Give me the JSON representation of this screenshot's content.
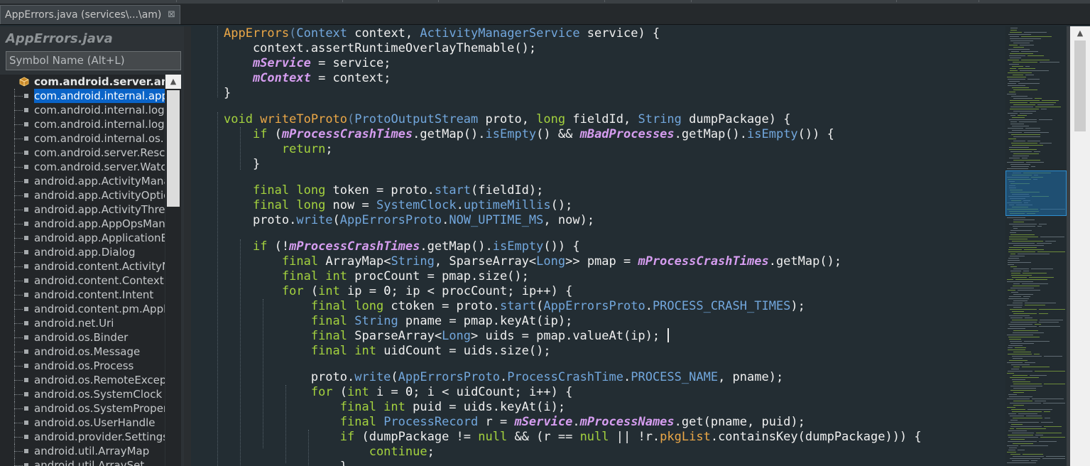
{
  "tab": {
    "title": "AppErrors.java (services\\...\\am)",
    "close": "⊠"
  },
  "outline": {
    "title": "AppErrors.java",
    "search_placeholder": "Symbol Name (Alt+L)",
    "items": [
      {
        "label": "com.android.server.am",
        "kind": "package",
        "bold": true
      },
      {
        "label": "com.android.internal.app",
        "kind": "import",
        "selected": true
      },
      {
        "label": "com.android.internal.logg",
        "kind": "import"
      },
      {
        "label": "com.android.internal.logg",
        "kind": "import"
      },
      {
        "label": "com.android.internal.os.P",
        "kind": "import"
      },
      {
        "label": "com.android.server.Rescu",
        "kind": "import"
      },
      {
        "label": "com.android.server.Watch",
        "kind": "import"
      },
      {
        "label": "android.app.ActivityMana",
        "kind": "import"
      },
      {
        "label": "android.app.ActivityOptio",
        "kind": "import"
      },
      {
        "label": "android.app.ActivityThrea",
        "kind": "import"
      },
      {
        "label": "android.app.AppOpsMan",
        "kind": "import"
      },
      {
        "label": "android.app.ApplicationE",
        "kind": "import"
      },
      {
        "label": "android.app.Dialog",
        "kind": "import"
      },
      {
        "label": "android.content.ActivityN",
        "kind": "import"
      },
      {
        "label": "android.content.Context",
        "kind": "import"
      },
      {
        "label": "android.content.Intent",
        "kind": "import"
      },
      {
        "label": "android.content.pm.Appl",
        "kind": "import"
      },
      {
        "label": "android.net.Uri",
        "kind": "import"
      },
      {
        "label": "android.os.Binder",
        "kind": "import"
      },
      {
        "label": "android.os.Message",
        "kind": "import"
      },
      {
        "label": "android.os.Process",
        "kind": "import"
      },
      {
        "label": "android.os.RemoteExcept",
        "kind": "import"
      },
      {
        "label": "android.os.SystemClock",
        "kind": "import"
      },
      {
        "label": "android.os.SystemProper",
        "kind": "import"
      },
      {
        "label": "android.os.UserHandle",
        "kind": "import"
      },
      {
        "label": "android.provider.Settings",
        "kind": "import"
      },
      {
        "label": "android.util.ArrayMap",
        "kind": "import"
      },
      {
        "label": "android.util.ArraySet",
        "kind": "import"
      }
    ]
  },
  "colors": {
    "keyword": "#a4d23e",
    "type": "#72a7dd",
    "field": "#d69df0",
    "method": "#eca847",
    "number": "#ffffff",
    "text": "#e8e2b7",
    "selection": "#0a64c8",
    "editor_bg": "#232d33"
  },
  "code_lines": [
    [
      {
        "c": "m",
        "t": "AppErrors"
      },
      {
        "c": "c",
        "t": "("
      },
      {
        "c": "t",
        "t": "Context"
      },
      {
        "c": "p",
        "t": " context, "
      },
      {
        "c": "t",
        "t": "ActivityManagerService"
      },
      {
        "c": "p",
        "t": " service) {"
      }
    ],
    [
      {
        "c": "p",
        "t": "    context.assertRuntimeOverlayThemable();"
      }
    ],
    [
      {
        "c": "p",
        "t": "    "
      },
      {
        "c": "f",
        "t": "mService"
      },
      {
        "c": "p",
        "t": " = service;"
      }
    ],
    [
      {
        "c": "p",
        "t": "    "
      },
      {
        "c": "f",
        "t": "mContext"
      },
      {
        "c": "p",
        "t": " = context;"
      }
    ],
    [
      {
        "c": "p",
        "t": "}"
      }
    ],
    [],
    [
      {
        "c": "k",
        "t": "void"
      },
      {
        "c": "p",
        "t": " "
      },
      {
        "c": "m",
        "t": "writeToProto"
      },
      {
        "c": "c",
        "t": "("
      },
      {
        "c": "t",
        "t": "ProtoOutputStream"
      },
      {
        "c": "p",
        "t": " proto, "
      },
      {
        "c": "k",
        "t": "long"
      },
      {
        "c": "p",
        "t": " fieldId, "
      },
      {
        "c": "t",
        "t": "String"
      },
      {
        "c": "p",
        "t": " dumpPackage) {"
      }
    ],
    [
      {
        "c": "p",
        "t": "    "
      },
      {
        "c": "k",
        "t": "if"
      },
      {
        "c": "p",
        "t": " ("
      },
      {
        "c": "f",
        "t": "mProcessCrashTimes"
      },
      {
        "c": "p",
        "t": ".getMap()."
      },
      {
        "c": "t",
        "t": "isEmpty"
      },
      {
        "c": "p",
        "t": "() && "
      },
      {
        "c": "f",
        "t": "mBadProcesses"
      },
      {
        "c": "p",
        "t": ".getMap()."
      },
      {
        "c": "t",
        "t": "isEmpty"
      },
      {
        "c": "p",
        "t": "()) {"
      }
    ],
    [
      {
        "c": "p",
        "t": "        "
      },
      {
        "c": "k",
        "t": "return"
      },
      {
        "c": "p",
        "t": ";"
      }
    ],
    [
      {
        "c": "p",
        "t": "    }"
      }
    ],
    [],
    [
      {
        "c": "p",
        "t": "    "
      },
      {
        "c": "k",
        "t": "final long"
      },
      {
        "c": "p",
        "t": " token = proto."
      },
      {
        "c": "t",
        "t": "start"
      },
      {
        "c": "p",
        "t": "(fieldId);"
      }
    ],
    [
      {
        "c": "p",
        "t": "    "
      },
      {
        "c": "k",
        "t": "final long"
      },
      {
        "c": "p",
        "t": " now = "
      },
      {
        "c": "t",
        "t": "SystemClock"
      },
      {
        "c": "p",
        "t": "."
      },
      {
        "c": "t",
        "t": "uptimeMillis"
      },
      {
        "c": "p",
        "t": "();"
      }
    ],
    [
      {
        "c": "p",
        "t": "    proto."
      },
      {
        "c": "t",
        "t": "write"
      },
      {
        "c": "p",
        "t": "("
      },
      {
        "c": "t",
        "t": "AppErrorsProto"
      },
      {
        "c": "p",
        "t": "."
      },
      {
        "c": "t",
        "t": "NOW_UPTIME_MS"
      },
      {
        "c": "p",
        "t": ", now);"
      }
    ],
    [],
    [
      {
        "c": "p",
        "t": "    "
      },
      {
        "c": "k",
        "t": "if"
      },
      {
        "c": "p",
        "t": " (!"
      },
      {
        "c": "f",
        "t": "mProcessCrashTimes"
      },
      {
        "c": "p",
        "t": ".getMap()."
      },
      {
        "c": "t",
        "t": "isEmpty"
      },
      {
        "c": "p",
        "t": "()) {"
      }
    ],
    [
      {
        "c": "p",
        "t": "        "
      },
      {
        "c": "k",
        "t": "final"
      },
      {
        "c": "p",
        "t": " ArrayMap<"
      },
      {
        "c": "t",
        "t": "String"
      },
      {
        "c": "p",
        "t": ", SparseArray<"
      },
      {
        "c": "t",
        "t": "Long"
      },
      {
        "c": "p",
        "t": ">> pmap = "
      },
      {
        "c": "f",
        "t": "mProcessCrashTimes"
      },
      {
        "c": "p",
        "t": ".getMap();"
      }
    ],
    [
      {
        "c": "p",
        "t": "        "
      },
      {
        "c": "k",
        "t": "final int"
      },
      {
        "c": "p",
        "t": " procCount = pmap.size();"
      }
    ],
    [
      {
        "c": "p",
        "t": "        "
      },
      {
        "c": "k",
        "t": "for"
      },
      {
        "c": "p",
        "t": " ("
      },
      {
        "c": "k",
        "t": "int"
      },
      {
        "c": "p",
        "t": " ip = "
      },
      {
        "c": "n",
        "t": "0"
      },
      {
        "c": "p",
        "t": "; ip < procCount; ip++) {"
      }
    ],
    [
      {
        "c": "p",
        "t": "            "
      },
      {
        "c": "k",
        "t": "final long"
      },
      {
        "c": "p",
        "t": " ctoken = proto."
      },
      {
        "c": "t",
        "t": "start"
      },
      {
        "c": "p",
        "t": "("
      },
      {
        "c": "t",
        "t": "AppErrorsProto"
      },
      {
        "c": "p",
        "t": "."
      },
      {
        "c": "t",
        "t": "PROCESS_CRASH_TIMES"
      },
      {
        "c": "p",
        "t": ");"
      }
    ],
    [
      {
        "c": "p",
        "t": "            "
      },
      {
        "c": "k",
        "t": "final"
      },
      {
        "c": "p",
        "t": " "
      },
      {
        "c": "t",
        "t": "String"
      },
      {
        "c": "p",
        "t": " pname = pmap.keyAt(ip);"
      }
    ],
    [
      {
        "c": "p",
        "t": "            "
      },
      {
        "c": "k",
        "t": "final"
      },
      {
        "c": "p",
        "t": " SparseArray<"
      },
      {
        "c": "t",
        "t": "Long"
      },
      {
        "c": "p",
        "t": "> uids = pmap.valueAt(ip);"
      }
    ],
    [
      {
        "c": "p",
        "t": "            "
      },
      {
        "c": "k",
        "t": "final int"
      },
      {
        "c": "p",
        "t": " uidCount = uids.size();"
      }
    ],
    [],
    [
      {
        "c": "p",
        "t": "            proto."
      },
      {
        "c": "t",
        "t": "write"
      },
      {
        "c": "p",
        "t": "("
      },
      {
        "c": "t",
        "t": "AppErrorsProto"
      },
      {
        "c": "p",
        "t": "."
      },
      {
        "c": "t",
        "t": "ProcessCrashTime"
      },
      {
        "c": "p",
        "t": "."
      },
      {
        "c": "t",
        "t": "PROCESS_NAME"
      },
      {
        "c": "p",
        "t": ", pname);"
      }
    ],
    [
      {
        "c": "p",
        "t": "            "
      },
      {
        "c": "k",
        "t": "for"
      },
      {
        "c": "p",
        "t": " ("
      },
      {
        "c": "k",
        "t": "int"
      },
      {
        "c": "p",
        "t": " i = "
      },
      {
        "c": "n",
        "t": "0"
      },
      {
        "c": "p",
        "t": "; i < uidCount; i++) {"
      }
    ],
    [
      {
        "c": "p",
        "t": "                "
      },
      {
        "c": "k",
        "t": "final int"
      },
      {
        "c": "p",
        "t": " puid = uids.keyAt(i);"
      }
    ],
    [
      {
        "c": "p",
        "t": "                "
      },
      {
        "c": "k",
        "t": "final"
      },
      {
        "c": "p",
        "t": " "
      },
      {
        "c": "t",
        "t": "ProcessRecord"
      },
      {
        "c": "p",
        "t": " r = "
      },
      {
        "c": "f",
        "t": "mService"
      },
      {
        "c": "p",
        "t": "."
      },
      {
        "c": "f",
        "t": "mProcessNames"
      },
      {
        "c": "p",
        "t": ".get(pname, puid);"
      }
    ],
    [
      {
        "c": "p",
        "t": "                "
      },
      {
        "c": "k",
        "t": "if"
      },
      {
        "c": "p",
        "t": " (dumpPackage != "
      },
      {
        "c": "k",
        "t": "null"
      },
      {
        "c": "p",
        "t": " && (r == "
      },
      {
        "c": "k",
        "t": "null"
      },
      {
        "c": "p",
        "t": " || !r."
      },
      {
        "c": "m",
        "t": "pkgList"
      },
      {
        "c": "p",
        "t": ".containsKey(dumpPackage))) {"
      }
    ],
    [
      {
        "c": "p",
        "t": "                    "
      },
      {
        "c": "k",
        "t": "continue"
      },
      {
        "c": "p",
        "t": ";"
      }
    ],
    [
      {
        "c": "p",
        "t": "                }"
      }
    ]
  ]
}
